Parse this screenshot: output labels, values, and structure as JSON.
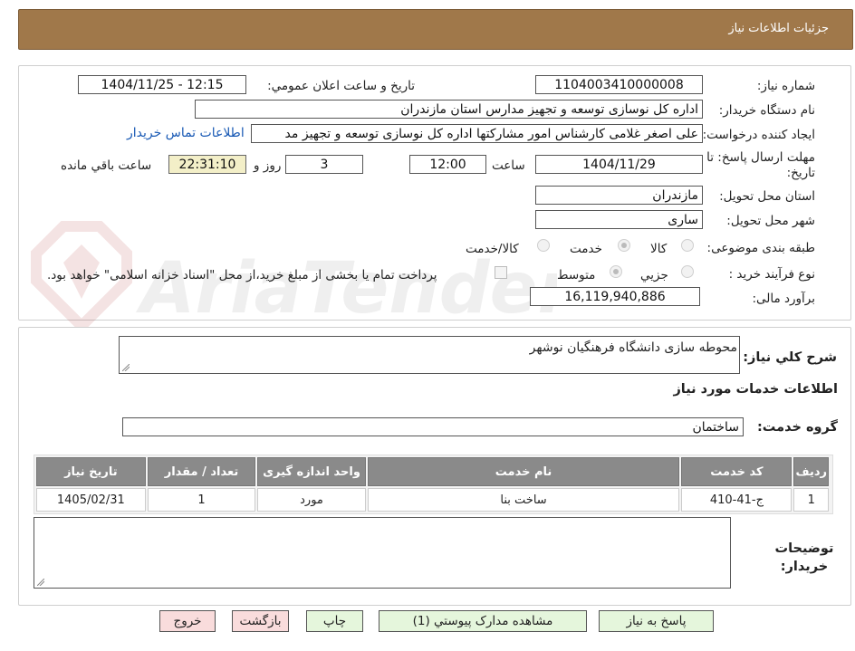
{
  "header": {
    "title": "جزئیات اطلاعات نیاز"
  },
  "form": {
    "need_number_label": "شماره نیاز:",
    "need_number": "1104003410000008",
    "announce_label": "تاریخ و ساعت اعلان عمومي:",
    "announce_value": "1404/11/25 - 12:15",
    "buyer_org_label": "نام دستگاه خريدار:",
    "buyer_org": "اداره کل نوسازی  توسعه و تجهیز مدارس استان مازندران",
    "requester_label": "ايجاد کننده درخواست:",
    "requester": "علی اصغر غلامی کارشناس امور مشارکتها اداره کل نوسازی  توسعه و تجهیز مد",
    "buyer_contact_link": "اطلاعات تماس خريدار",
    "deadline_label": "مهلت ارسال پاسخ: تا تاریخ:",
    "deadline_date": "1404/11/29",
    "time_label": "ساعت",
    "deadline_time": "12:00",
    "days_value": "3",
    "day_and_label": "روز و",
    "remaining_time": "22:31:10",
    "remaining_label": "ساعت باقي مانده",
    "province_label": "استان محل تحويل:",
    "province": "مازندران",
    "city_label": "شهر محل تحويل:",
    "city": "ساری",
    "category_label": "طبقه بندی موضوعی:",
    "category_options": [
      "کالا",
      "خدمت",
      "کالا/خدمت"
    ],
    "category_selected": "خدمت",
    "process_label": "نوع فرآيند خريد :",
    "process_options": [
      "جزيي",
      "متوسط"
    ],
    "process_selected": "متوسط",
    "payment_note": "پرداخت تمام یا بخشی از مبلغ خرید،از محل \"اسناد خزانه اسلامی\" خواهد بود.",
    "budget_label": "برآورد مالی:",
    "budget": "16,119,940,886"
  },
  "description": {
    "label": "شرح کلي نياز:",
    "value": "محوطه سازی دانشگاه فرهنگیان نوشهر",
    "services_heading": "اطلاعات خدمات مورد نياز",
    "service_group_label": "گروه خدمت:",
    "service_group": "ساختمان"
  },
  "table": {
    "headers": [
      "رديف",
      "کد خدمت",
      "نام خدمت",
      "واحد اندازه گيری",
      "تعداد / مقدار",
      "تاريخ نياز"
    ],
    "rows": [
      [
        "1",
        "ج-41-410",
        "ساخت بنا",
        "مورد",
        "1",
        "1405/02/31"
      ]
    ]
  },
  "notes": {
    "label": "توضيحات خريدار:",
    "value": ""
  },
  "buttons": {
    "reply": "پاسخ به نياز",
    "attachments": "مشاهده مدارک پيوستي (1)",
    "print": "چاپ",
    "back": "بازگشت",
    "exit": "خروج"
  },
  "watermark": {
    "text": "AriaTender.net"
  }
}
